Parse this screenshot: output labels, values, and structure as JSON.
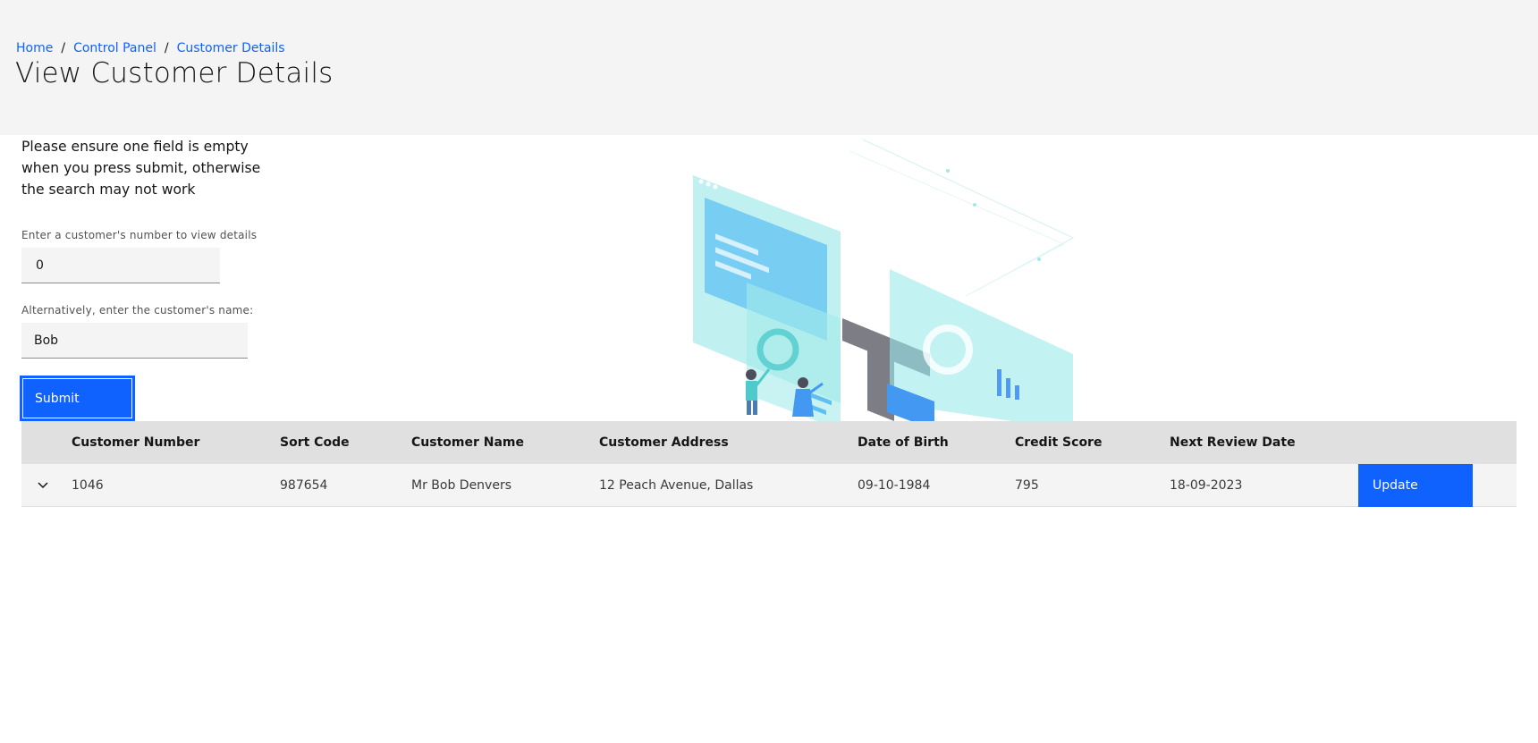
{
  "breadcrumb": {
    "items": [
      "Home",
      "Control Panel",
      "Customer Details"
    ],
    "separator": "/"
  },
  "page_title": "View Customer Details",
  "instructions": "Please ensure one field is empty when you press submit, otherwise the search may not work",
  "form": {
    "number_label": "Enter a customer's number to view details",
    "number_value": "0",
    "name_label": "Alternatively, enter the customer's name:",
    "name_value": "Bob",
    "submit_label": "Submit"
  },
  "table": {
    "headers": [
      "Customer Number",
      "Sort Code",
      "Customer Name",
      "Customer Address",
      "Date of Birth",
      "Credit Score",
      "Next Review Date"
    ],
    "rows": [
      {
        "customer_number": "1046",
        "sort_code": "987654",
        "customer_name": "Mr Bob Denvers",
        "customer_address": "12 Peach Avenue, Dallas",
        "date_of_birth": "09-10-1984",
        "credit_score": "795",
        "next_review_date": "18-09-2023",
        "action_label": "Update"
      }
    ]
  },
  "icons": {
    "expand": "chevron-down-icon",
    "illustration": "isometric-dashboard-illustration"
  },
  "colors": {
    "accent": "#0f62fe",
    "header_bg": "#f4f4f4",
    "table_head_bg": "#e0e0e0"
  }
}
